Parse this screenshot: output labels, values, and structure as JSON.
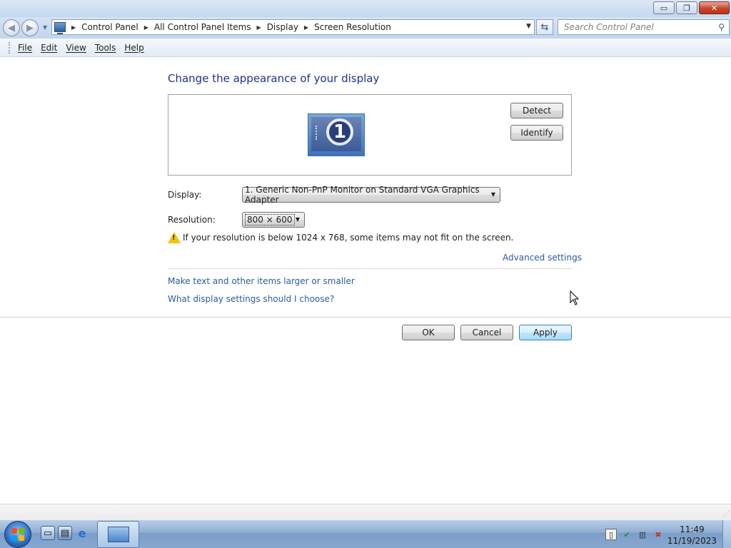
{
  "window": {
    "buttons": {
      "minimize": "▭",
      "restore": "❐",
      "close": "✕"
    }
  },
  "address": {
    "crumbs": [
      "Control Panel",
      "All Control Panel Items",
      "Display",
      "Screen Resolution"
    ],
    "search_placeholder": "Search Control Panel"
  },
  "menu": [
    "File",
    "Edit",
    "View",
    "Tools",
    "Help"
  ],
  "page": {
    "heading": "Change the appearance of your display",
    "monitor_number": "1",
    "detect_label": "Detect",
    "identify_label": "Identify",
    "display_label": "Display:",
    "display_value": "1. Generic Non-PnP Monitor on Standard VGA Graphics Adapter",
    "resolution_label": "Resolution:",
    "resolution_value": "800 × 600",
    "warning_text": "If your resolution is below 1024 x 768, some items may not fit on the screen.",
    "advanced_link": "Advanced settings",
    "link_text_size": "Make text and other items larger or smaller",
    "link_what_settings": "What display settings should I choose?",
    "ok_label": "OK",
    "cancel_label": "Cancel",
    "apply_label": "Apply"
  },
  "taskbar": {
    "time": "11:49",
    "date": "11/19/2023",
    "pinned_icons": [
      "computer-icon",
      "server-manager-icon",
      "internet-explorer-icon"
    ],
    "tray_icons": [
      "notepad-icon",
      "action-center-icon",
      "network-icon",
      "volume-muted-icon"
    ]
  },
  "colors": {
    "heading": "#1e3287",
    "link": "#2a5b9e",
    "warning": "#f1c40f"
  }
}
